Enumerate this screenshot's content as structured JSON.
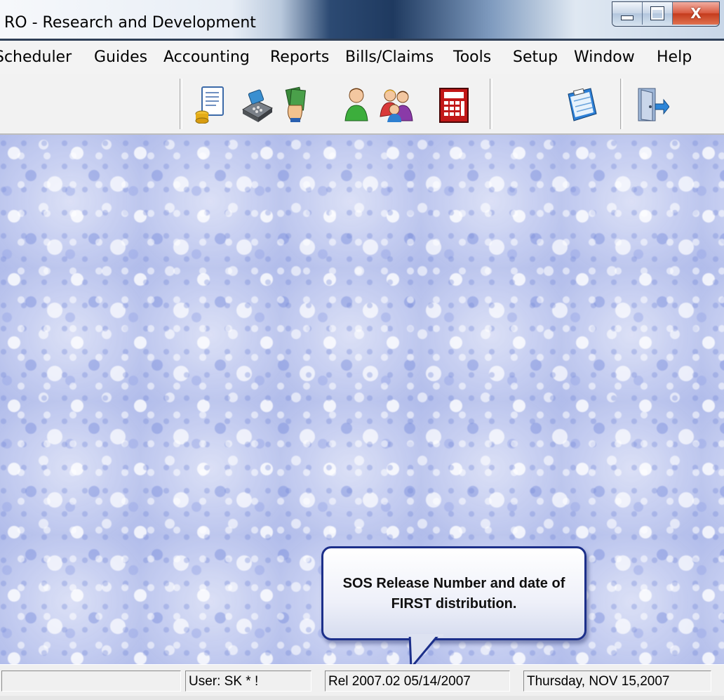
{
  "window": {
    "title": "RO - Research and Development"
  },
  "menu": [
    "Scheduler",
    "Guides",
    "Accounting",
    "Reports",
    "Bills/Claims",
    "Tools",
    "Setup",
    "Window",
    "Help"
  ],
  "toolbar": {
    "buttons": [
      "document-database-icon",
      "cash-register-icon",
      "money-hand-icon",
      "person-icon",
      "people-group-icon",
      "calculator-icon",
      "calendar-icon",
      "exit-door-icon"
    ]
  },
  "callout": {
    "text": "SOS Release Number and date of FIRST distribution."
  },
  "status": {
    "panel1": "",
    "user": "User: SK * !",
    "release": "Rel 2007.02  05/14/2007",
    "date": "Thursday, NOV 15,2007"
  }
}
